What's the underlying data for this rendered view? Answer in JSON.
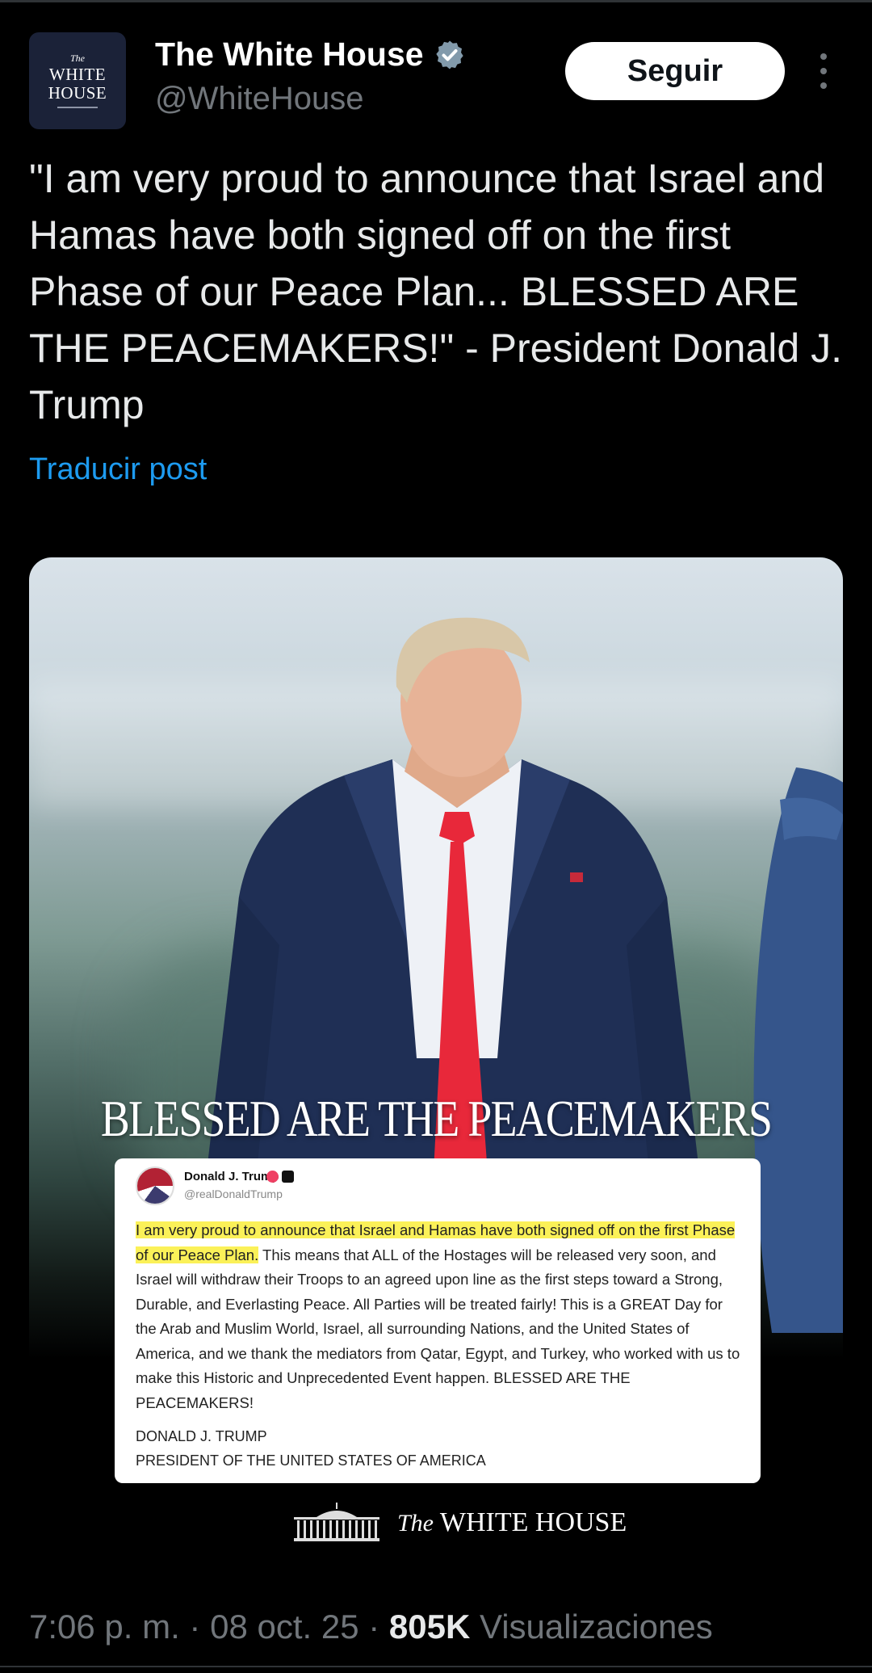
{
  "account": {
    "display_name": "The White House",
    "handle": "@WhiteHouse",
    "avatar_small": "The",
    "avatar_line1": "WHITE",
    "avatar_line2": "HOUSE"
  },
  "actions": {
    "follow_label": "Seguir"
  },
  "post": {
    "text": "\"I am very proud to announce that Israel and Hamas have both signed off on the first Phase of our Peace Plan... BLESSED ARE THE PEACEMAKERS!\" - President Donald J. Trump",
    "translate_label": "Traducir post"
  },
  "media": {
    "banner_text": "BLESSED ARE THE PEACEMAKERS",
    "embedded_post": {
      "name": "Donald J. Trump",
      "handle": "@realDonaldTrump",
      "highlighted_text": "I am very proud to announce that Israel and Hamas have both signed off on the first Phase of our Peace Plan.",
      "body_text": " This means that ALL of the Hostages will be released very soon, and Israel will withdraw their Troops to an agreed upon line as the first steps toward a Strong, Durable, and Everlasting Peace. All Parties will be treated fairly! This is a GREAT Day for the Arab and Muslim World, Israel, all surrounding Nations, and the United States of America, and we thank the mediators from Qatar, Egypt, and Turkey, who worked with us to make this Historic and Unprecedented Event happen. BLESSED ARE THE PEACEMAKERS!",
      "signature_name": "DONALD J. TRUMP",
      "signature_title": "PRESIDENT OF THE UNITED STATES OF AMERICA"
    },
    "wordmark_the": "The",
    "wordmark_name": "WHITE HOUSE"
  },
  "meta": {
    "time": "7:06 p. m.",
    "date": "08 oct. 25",
    "views_count": "805K",
    "views_label": "Visualizaciones"
  },
  "colors": {
    "background": "#000000",
    "link": "#1d9bf0",
    "verified": "#829aab",
    "tie": "#e8283a",
    "highlight": "#fbf158"
  }
}
